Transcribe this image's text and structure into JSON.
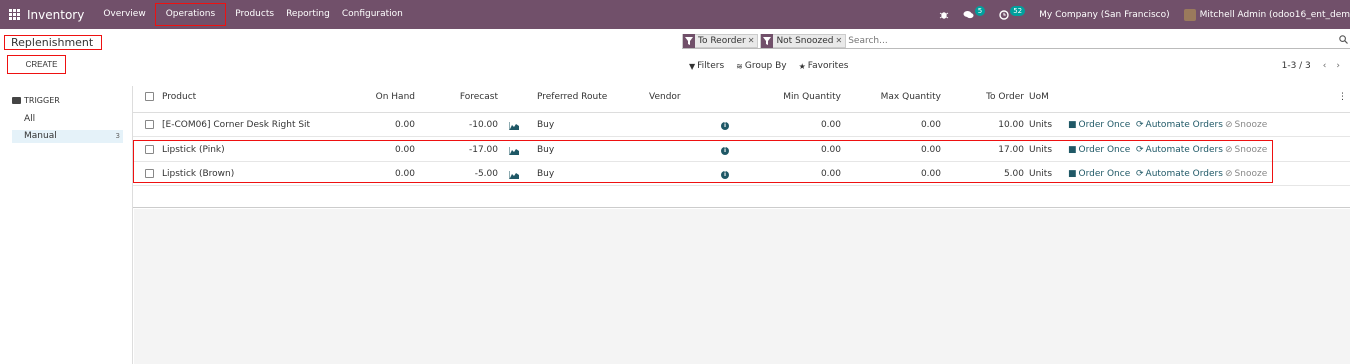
{
  "navbar": {
    "app_name": "Inventory",
    "menu": [
      "Overview",
      "Operations",
      "Products",
      "Reporting",
      "Configuration"
    ],
    "messages_count": "5",
    "activities_count": "52",
    "company": "My Company (San Francisco)",
    "user": "Mitchell Admin (odoo16_ent_dem",
    "bar_color": "#71506a"
  },
  "breadcrumb": "Replenishment",
  "create_label": "CREATE",
  "search": {
    "facets": [
      "To Reorder",
      "Not Snoozed"
    ],
    "placeholder": "Search..."
  },
  "filters": {
    "filters": "Filters",
    "group_by": "Group By",
    "favorites": "Favorites"
  },
  "pager": "1-3 / 3",
  "sidepanel": {
    "title": "TRIGGER",
    "items": [
      {
        "label": "All",
        "count": ""
      },
      {
        "label": "Manual",
        "count": "3"
      }
    ]
  },
  "table": {
    "columns": [
      "Product",
      "On Hand",
      "Forecast",
      "Preferred Route",
      "Vendor",
      "Min Quantity",
      "Max Quantity",
      "To Order",
      "UoM"
    ],
    "rows": [
      {
        "product": "[E-COM06] Corner Desk Right Sit",
        "on_hand": "0.00",
        "forecast": "-10.00",
        "route": "Buy",
        "min": "0.00",
        "max": "0.00",
        "to_order": "10.00",
        "uom": "Units"
      },
      {
        "product": "Lipstick (Pink)",
        "on_hand": "0.00",
        "forecast": "-17.00",
        "route": "Buy",
        "min": "0.00",
        "max": "0.00",
        "to_order": "17.00",
        "uom": "Units"
      },
      {
        "product": "Lipstick (Brown)",
        "on_hand": "0.00",
        "forecast": "-5.00",
        "route": "Buy",
        "min": "0.00",
        "max": "0.00",
        "to_order": "5.00",
        "uom": "Units"
      }
    ],
    "actions": {
      "order_once": "Order Once",
      "automate": "Automate Orders",
      "snooze": "Snooze"
    }
  },
  "colors": {
    "accent": "#1f5866",
    "highlight_border": "#e11111"
  }
}
